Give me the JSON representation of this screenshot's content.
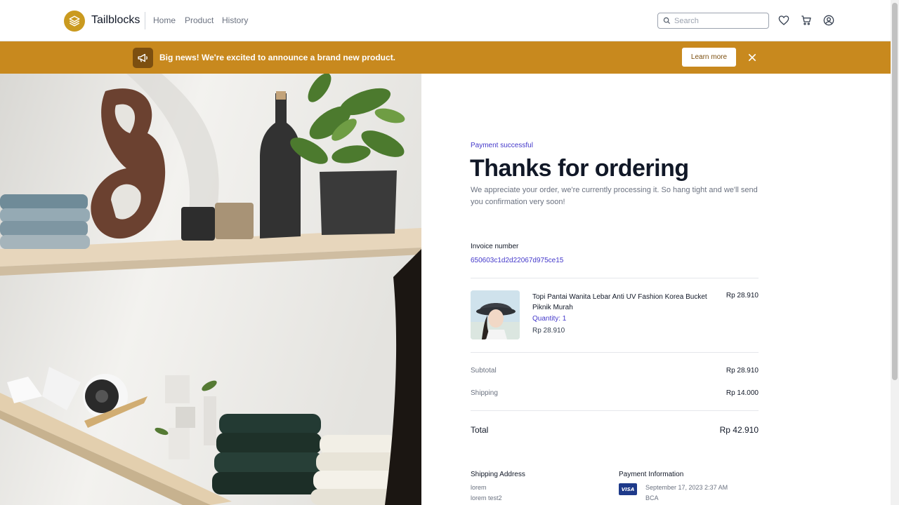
{
  "header": {
    "brand": "Tailblocks",
    "nav": [
      "Home",
      "Product",
      "History"
    ],
    "search_placeholder": "Search",
    "icons": [
      "heart-icon",
      "cart-icon",
      "user-icon"
    ]
  },
  "banner": {
    "message": "Big news! We're excited to announce a brand new product.",
    "button": "Learn more",
    "icons": [
      "megaphone-icon",
      "close-icon"
    ]
  },
  "receipt": {
    "status": "Payment successful",
    "title": "Thanks for ordering",
    "description": "We appreciate your order, we're currently processing it. So hang tight and we'll send you confirmation very soon!",
    "invoice_label": "Invoice number",
    "invoice_number": "650603c1d2d22067d975ce15",
    "item": {
      "name": "Topi Pantai Wanita Lebar Anti UV Fashion Korea Bucket Piknik Murah",
      "quantity": "Quantity: 1",
      "price": "Rp 28.910",
      "line_total": "Rp 28.910"
    },
    "subtotal_label": "Subtotal",
    "subtotal": "Rp 28.910",
    "shipping_label": "Shipping",
    "shipping": "Rp 14.000",
    "total_label": "Total",
    "total": "Rp 42.910",
    "shipping_address": {
      "label": "Shipping Address",
      "line1": "lorem",
      "line2": "lorem test2"
    },
    "payment": {
      "label": "Payment Information",
      "card_brand": "VISA",
      "datetime": "September 17, 2023 2:37 AM",
      "bank": "BCA"
    }
  },
  "colors": {
    "accent": "#4338ca",
    "banner": "#c8891e",
    "logo": "#ca9a1f"
  }
}
